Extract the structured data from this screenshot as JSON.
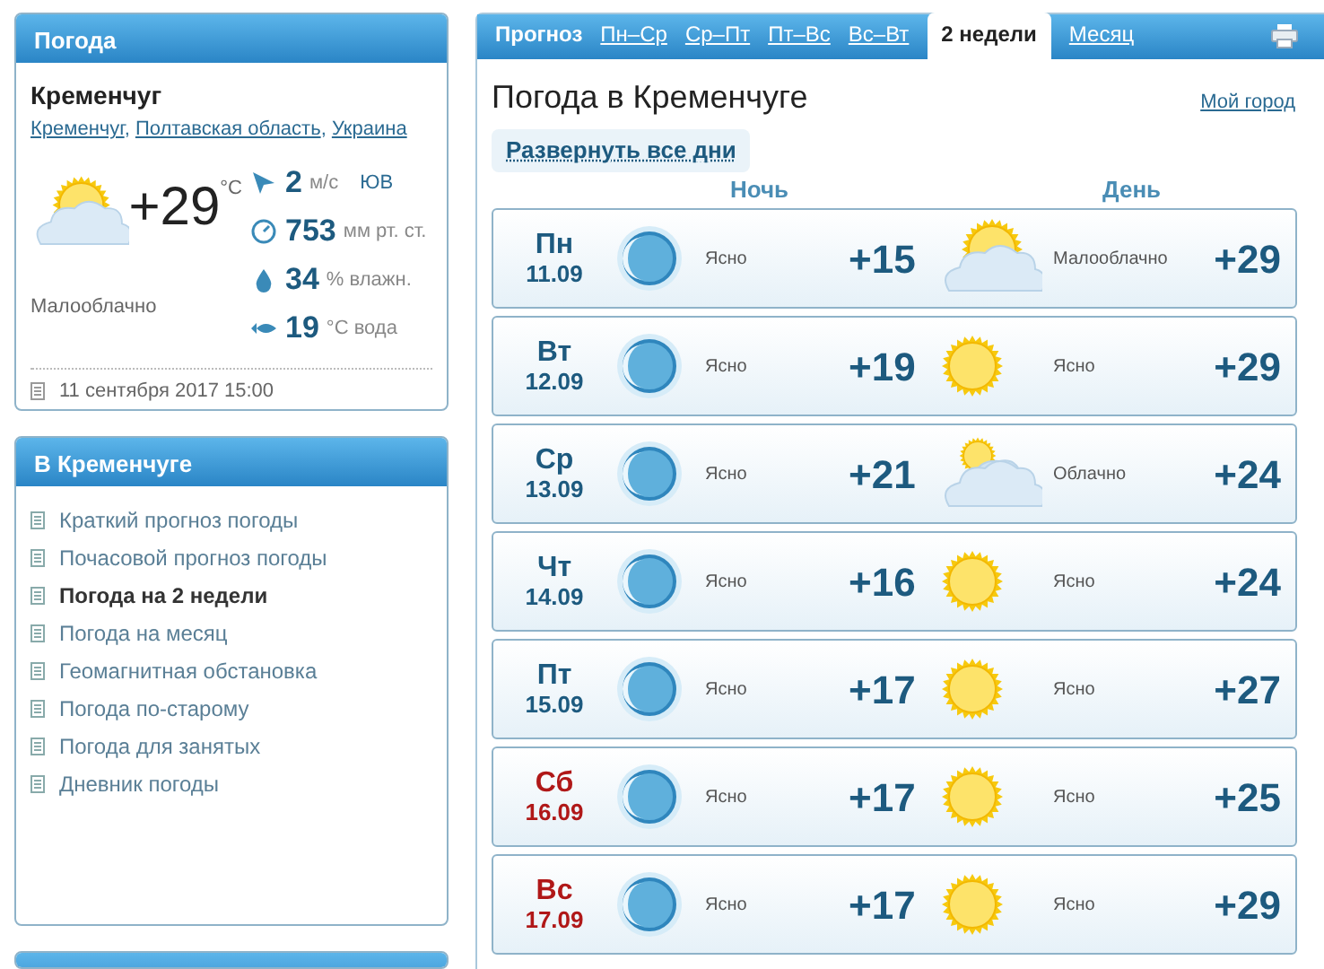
{
  "current": {
    "title": "Погода",
    "city": "Кременчуг",
    "location_links": [
      "Кременчуг",
      "Полтавская область",
      "Украина"
    ],
    "link_separator": ",",
    "kind": "partly_cloudy",
    "temperature": "+29",
    "unit": "°C",
    "condition": "Малооблачно",
    "stats": [
      {
        "kind": "wind",
        "value": "2",
        "unit": "м/с",
        "extra": "ЮВ"
      },
      {
        "kind": "pressure",
        "value": "753",
        "unit": "мм рт. ст."
      },
      {
        "kind": "humidity",
        "value": "34",
        "unit": "% влажн."
      },
      {
        "kind": "water",
        "value": "19",
        "unit": "°C вода"
      }
    ],
    "updated": "11 сентября 2017 15:00"
  },
  "menu": {
    "title": "В Кременчуге",
    "items": [
      {
        "label": "Краткий прогноз погоды",
        "selected": false
      },
      {
        "label": "Почасовой прогноз погоды",
        "selected": false
      },
      {
        "label": "Погода на 2 недели",
        "selected": true
      },
      {
        "label": "Погода на месяц",
        "selected": false
      },
      {
        "label": "Геомагнитная обстановка",
        "selected": false
      },
      {
        "label": "Погода по-старому",
        "selected": false
      },
      {
        "label": "Погода для занятых",
        "selected": false
      },
      {
        "label": "Дневник погоды",
        "selected": false
      }
    ]
  },
  "forecast": {
    "tabs_label": "Прогноз",
    "tabs": [
      {
        "label": "Пн–Ср",
        "selected": false
      },
      {
        "label": "Ср–Пт",
        "selected": false
      },
      {
        "label": "Пт–Вс",
        "selected": false
      },
      {
        "label": "Вс–Вт",
        "selected": false
      },
      {
        "label": "2 недели",
        "selected": true
      },
      {
        "label": "Месяц",
        "selected": false
      }
    ],
    "title": "Погода в Кременчуге",
    "my_city": "Мой город",
    "expand": "Развернуть все дни",
    "night_label": "Ночь",
    "day_label": "День",
    "days": [
      {
        "day": "Пн",
        "date": "11.09",
        "weekend": false,
        "night": {
          "kind": "moon",
          "condition": "Ясно",
          "temp": "+15"
        },
        "daytime": {
          "kind": "partly_cloudy",
          "condition": "Малооблачно",
          "temp": "+29"
        }
      },
      {
        "day": "Вт",
        "date": "12.09",
        "weekend": false,
        "night": {
          "kind": "moon",
          "condition": "Ясно",
          "temp": "+19"
        },
        "daytime": {
          "kind": "sun",
          "condition": "Ясно",
          "temp": "+29"
        }
      },
      {
        "day": "Ср",
        "date": "13.09",
        "weekend": false,
        "night": {
          "kind": "moon",
          "condition": "Ясно",
          "temp": "+21"
        },
        "daytime": {
          "kind": "cloudy",
          "condition": "Облачно",
          "temp": "+24"
        }
      },
      {
        "day": "Чт",
        "date": "14.09",
        "weekend": false,
        "night": {
          "kind": "moon",
          "condition": "Ясно",
          "temp": "+16"
        },
        "daytime": {
          "kind": "sun",
          "condition": "Ясно",
          "temp": "+24"
        }
      },
      {
        "day": "Пт",
        "date": "15.09",
        "weekend": false,
        "night": {
          "kind": "moon",
          "condition": "Ясно",
          "temp": "+17"
        },
        "daytime": {
          "kind": "sun",
          "condition": "Ясно",
          "temp": "+27"
        }
      },
      {
        "day": "Сб",
        "date": "16.09",
        "weekend": true,
        "night": {
          "kind": "moon",
          "condition": "Ясно",
          "temp": "+17"
        },
        "daytime": {
          "kind": "sun",
          "condition": "Ясно",
          "temp": "+25"
        }
      },
      {
        "day": "Вс",
        "date": "17.09",
        "weekend": true,
        "night": {
          "kind": "moon",
          "condition": "Ясно",
          "temp": "+17"
        },
        "daytime": {
          "kind": "sun",
          "condition": "Ясно",
          "temp": "+29"
        }
      }
    ]
  }
}
